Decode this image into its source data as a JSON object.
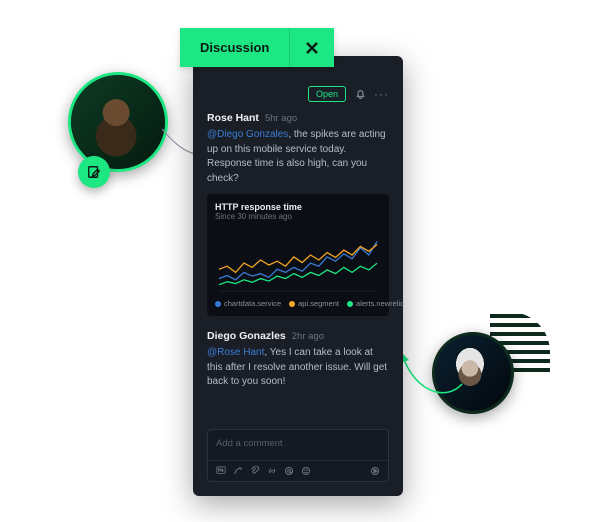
{
  "tab": {
    "label": "Discussion"
  },
  "status": {
    "label": "Open"
  },
  "messages": [
    {
      "author": "Rose Hant",
      "time": "5hr ago",
      "mention": "@Diego Gonzales",
      "body": ",  the spikes are acting up on this mobile service today. Response time is also high, can you check?"
    },
    {
      "author": "Diego Gonazles",
      "time": "2hr ago",
      "mention": "@Rose Hant",
      "body": ", Yes I can take a look at this after I resolve another issue. Will get back to you soon!"
    }
  ],
  "chart": {
    "title": "HTTP response time",
    "subtitle": "Since 30 minutes ago",
    "legend": [
      {
        "name": "chartdata.service",
        "color": "#3a7bd5"
      },
      {
        "name": "api.segment",
        "color": "#f5a623"
      },
      {
        "name": "alerts.newrelic",
        "color": "#1ce783"
      }
    ]
  },
  "chart_data": {
    "type": "line",
    "title": "HTTP response time",
    "xlabel": "",
    "ylabel": "",
    "ylim": [
      0,
      100
    ],
    "x": [
      0,
      1,
      2,
      3,
      4,
      5,
      6,
      7,
      8,
      9,
      10,
      11,
      12,
      13,
      14,
      15,
      16,
      17,
      18,
      19
    ],
    "series": [
      {
        "name": "chartdata.service",
        "color": "#3a7bd5",
        "values": [
          20,
          25,
          18,
          30,
          24,
          28,
          22,
          35,
          30,
          38,
          32,
          45,
          40,
          55,
          48,
          60,
          52,
          70,
          58,
          80
        ]
      },
      {
        "name": "api.segment",
        "color": "#f5a623",
        "values": [
          35,
          40,
          30,
          45,
          38,
          50,
          42,
          48,
          40,
          55,
          46,
          58,
          50,
          62,
          54,
          66,
          58,
          72,
          64,
          75
        ]
      },
      {
        "name": "alerts.newrelic",
        "color": "#1ce783",
        "values": [
          10,
          15,
          12,
          18,
          14,
          20,
          16,
          24,
          20,
          28,
          22,
          30,
          25,
          34,
          28,
          38,
          30,
          40,
          34,
          45
        ]
      }
    ]
  },
  "composer": {
    "placeholder": "Add a comment"
  },
  "colors": {
    "brand_green": "#1ce783",
    "panel_bg": "#1a1f27",
    "mention": "#3a7bd5"
  }
}
